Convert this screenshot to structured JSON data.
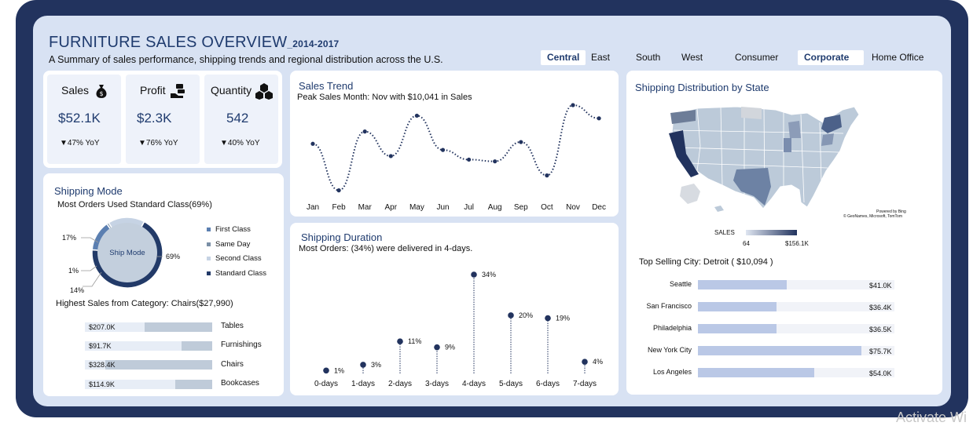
{
  "header": {
    "title": "FURNITURE SALES OVERVIEW",
    "title_years": "_2014-2017",
    "subtitle": "A Summary of sales performance, shipping trends and regional distribution across the U.S."
  },
  "filters": {
    "regions": [
      {
        "label": "Central",
        "selected": true
      },
      {
        "label": "East",
        "selected": false
      },
      {
        "label": "South",
        "selected": false
      },
      {
        "label": "West",
        "selected": false
      }
    ],
    "segments": [
      {
        "label": "Consumer",
        "selected": false
      },
      {
        "label": "Corporate",
        "selected": true
      },
      {
        "label": "Home Office",
        "selected": false
      }
    ]
  },
  "kpis": {
    "sales": {
      "label": "Sales",
      "value": "$52.1K",
      "yoy": "▼47% YoY",
      "icon": "money-bag-icon"
    },
    "profit": {
      "label": "Profit",
      "value": "$2.3K",
      "yoy": "▼76% YoY",
      "icon": "money-hand-icon"
    },
    "quantity": {
      "label": "Quantity",
      "value": "542",
      "yoy": "▼40% YoY",
      "icon": "boxes-icon"
    }
  },
  "sales_trend": {
    "title": "Sales Trend",
    "subtitle": "Peak Sales Month: Nov with $10,041 in Sales",
    "months": [
      "Jan",
      "Feb",
      "Mar",
      "Apr",
      "May",
      "Jun",
      "Jul",
      "Aug",
      "Sep",
      "Oct",
      "Nov",
      "Dec"
    ],
    "values": [
      0.56,
      0.03,
      0.7,
      0.42,
      0.88,
      0.49,
      0.38,
      0.36,
      0.58,
      0.2,
      1.0,
      0.85
    ]
  },
  "shipping_mode": {
    "title": "Shipping Mode",
    "subtitle": "Most Orders Used Standard Class(69%)",
    "center_label": "Ship Mode",
    "slices": [
      {
        "name": "First Class",
        "pct": 14,
        "label": "14%",
        "color": "#5b7fb1"
      },
      {
        "name": "Same Day",
        "pct": 1,
        "label": "1%",
        "color": "#7a8fa6"
      },
      {
        "name": "Second Class",
        "pct": 17,
        "label": "17%",
        "color": "#c6d3e4"
      },
      {
        "name": "Standard Class",
        "pct": 69,
        "label": "69%",
        "color": "#223a68"
      }
    ],
    "category_title": "Highest Sales from Category: Chairs($27,990)",
    "categories": [
      {
        "name": "Tables",
        "value": "$207.0K",
        "share": 0.53
      },
      {
        "name": "Furnishings",
        "value": "$91.7K",
        "share": 0.24
      },
      {
        "name": "Chairs",
        "value": "$328.4K",
        "share": 0.84
      },
      {
        "name": "Bookcases",
        "value": "$114.9K",
        "share": 0.29
      }
    ]
  },
  "shipping_duration": {
    "title": "Shipping Duration",
    "subtitle": "Most Orders: (34%) were delivered in 4-days.",
    "chart_data": {
      "type": "scatter",
      "categories": [
        "0-days",
        "1-days",
        "2-days",
        "3-days",
        "4-days",
        "5-days",
        "6-days",
        "7-days"
      ],
      "values": [
        1,
        3,
        11,
        9,
        34,
        20,
        19,
        4
      ],
      "labels": [
        "1%",
        "3%",
        "11%",
        "9%",
        "34%",
        "20%",
        "19%",
        "4%"
      ],
      "ylim": [
        0,
        34
      ]
    }
  },
  "shipping_map": {
    "title": "Shipping Distribution by State",
    "legend_title": "SALES",
    "legend_min": "64",
    "legend_max": "$156.1K",
    "attribution_1": "Powered by Bing",
    "attribution_2": "© GeoNames, Microsoft, TomTom",
    "top_city_text": "Top Selling City: Detroit ( $10,094 )",
    "cities": [
      {
        "name": "Seattle",
        "value": "$41.0K",
        "share": 0.45
      },
      {
        "name": "San Francisco",
        "value": "$36.4K",
        "share": 0.4
      },
      {
        "name": "Philadelphia",
        "value": "$36.5K",
        "share": 0.4
      },
      {
        "name": "New York City",
        "value": "$75.7K",
        "share": 0.83
      },
      {
        "name": "Los Angeles",
        "value": "$54.0K",
        "share": 0.59
      }
    ]
  },
  "watermark": "Activate Wi"
}
